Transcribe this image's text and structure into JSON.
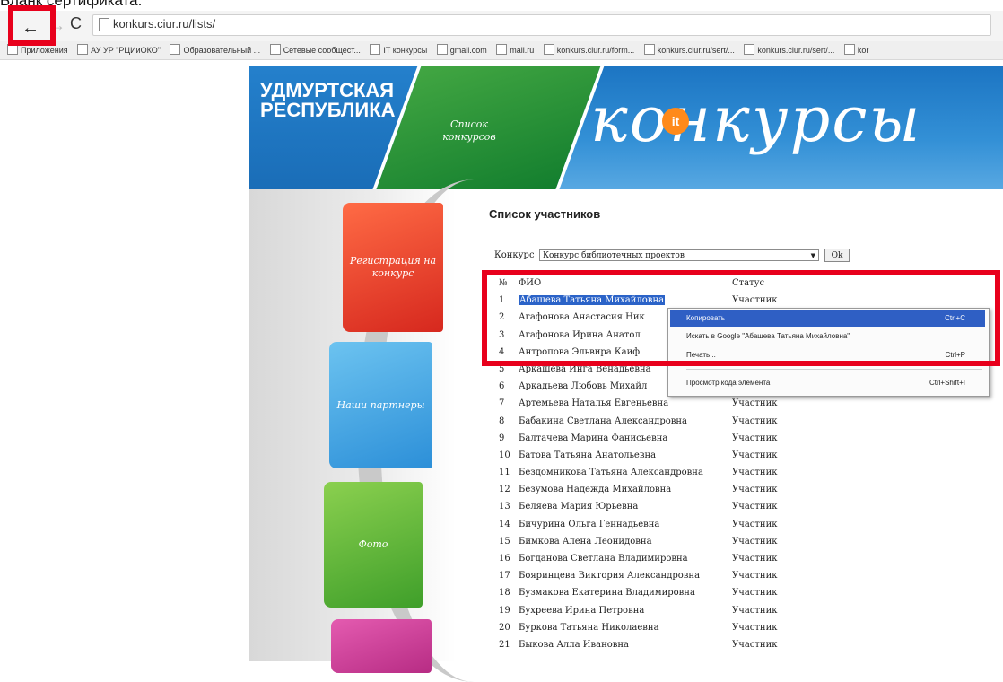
{
  "caption": "Бланк сертификата:",
  "browser": {
    "back_icon": "←",
    "forward_icon": "→",
    "reload_icon": "C",
    "url": "konkurs.ciur.ru/lists/",
    "bookmarks": [
      "Приложения",
      "АУ УР \"РЦИиОКО\"",
      "Образовательный ...",
      "Сетевые сообщест...",
      "IT конкурсы",
      "gmail.com",
      "mail.ru",
      "konkurs.ciur.ru/form...",
      "konkurs.ciur.ru/sert/...",
      "konkurs.ciur.ru/sert/...",
      "kor"
    ]
  },
  "banner": {
    "region": "УДМУРТСКАЯ РЕСПУБЛИКА",
    "green_label": "Список конкурсов",
    "logo_text": "конкурсы",
    "logo_badge": "it"
  },
  "nav": {
    "registration": "Регистрация на конкурс",
    "libraries": "Наши партнеры",
    "photos": "Фото"
  },
  "page_title": "Список участников",
  "contest": {
    "label": "Конкурс",
    "selected": "Конкурс библиотечных проектов",
    "ok": "Ok"
  },
  "table": {
    "headers": {
      "num": "№",
      "fio": "ФИО",
      "status": "Статус"
    },
    "rows": [
      {
        "num": "1",
        "fio": "Абашева Татьяна Михайловна",
        "status": "Участник"
      },
      {
        "num": "2",
        "fio": "Агафонова Анастасия Ник",
        "status": ""
      },
      {
        "num": "3",
        "fio": "Агафонова Ирина Анатол",
        "status": ""
      },
      {
        "num": "4",
        "fio": "Антропова Эльвира Каиф",
        "status": ""
      },
      {
        "num": "5",
        "fio": "Аркашева Инга Венадьевна",
        "status": ""
      },
      {
        "num": "6",
        "fio": "Аркадьева Любовь Михайл",
        "status": ""
      },
      {
        "num": "7",
        "fio": "Артемьева Наталья Евгеньевна",
        "status": "Участник"
      },
      {
        "num": "8",
        "fio": "Бабакина Светлана Александровна",
        "status": "Участник"
      },
      {
        "num": "9",
        "fio": "Балтачева Марина Фанисьевна",
        "status": "Участник"
      },
      {
        "num": "10",
        "fio": "Батова Татьяна Анатольевна",
        "status": "Участник"
      },
      {
        "num": "11",
        "fio": "Бездомникова Татьяна Александровна",
        "status": "Участник"
      },
      {
        "num": "12",
        "fio": "Безумова Надежда Михайловна",
        "status": "Участник"
      },
      {
        "num": "13",
        "fio": "Беляева Мария Юрьевна",
        "status": "Участник"
      },
      {
        "num": "14",
        "fio": "Бичурина Ольга Геннадьевна",
        "status": "Участник"
      },
      {
        "num": "15",
        "fio": "Бимкова Алена Леонидовна",
        "status": "Участник"
      },
      {
        "num": "16",
        "fio": "Богданова Светлана Владимировна",
        "status": "Участник"
      },
      {
        "num": "17",
        "fio": "Бояринцева Виктория Александровна",
        "status": "Участник"
      },
      {
        "num": "18",
        "fio": "Бузмакова Екатерина Владимировна",
        "status": "Участник"
      },
      {
        "num": "19",
        "fio": "Бухреева Ирина Петровна",
        "status": "Участник"
      },
      {
        "num": "20",
        "fio": "Буркова Татьяна Николаевна",
        "status": "Участник"
      },
      {
        "num": "21",
        "fio": "Быкова Алла Ивановна",
        "status": "Участник"
      }
    ]
  },
  "context_menu": {
    "items": [
      {
        "label": "Копировать",
        "shortcut": "Ctrl+C"
      },
      {
        "label": "Искать в Google \"Абашева Татьяна Михайловна\"",
        "shortcut": ""
      },
      {
        "label": "Печать...",
        "shortcut": "Ctrl+P"
      },
      {
        "label": "Просмотр кода элемента",
        "shortcut": "Ctrl+Shift+I"
      }
    ]
  },
  "colors": {
    "highlight_red": "#e8001c",
    "selection_blue": "#2b63c8",
    "banner_blue": "#1c75c3"
  }
}
